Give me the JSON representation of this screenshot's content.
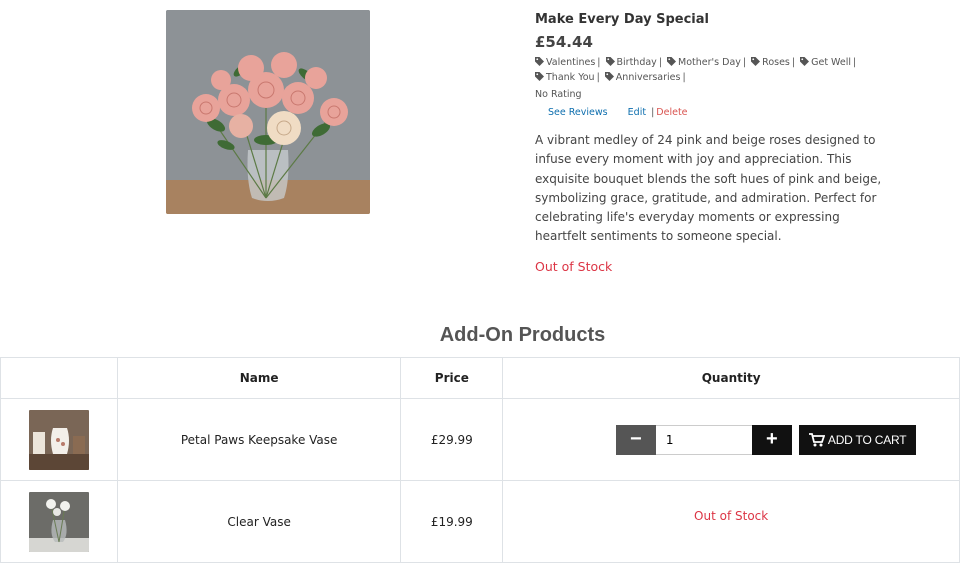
{
  "product": {
    "title": "Make Every Day Special",
    "price": "£54.44",
    "tags": [
      "Valentines",
      "Birthday",
      "Mother's Day",
      "Roses",
      "Get Well",
      "Thank You",
      "Anniversaries"
    ],
    "rating": "No Rating",
    "see_reviews": "See Reviews",
    "edit": "Edit",
    "delete": "Delete",
    "divider": "|",
    "description": "A vibrant medley of 24 pink and beige roses designed to infuse every moment with joy and appreciation. This exquisite bouquet blends the soft hues of pink and beige, symbolizing grace, gratitude, and admiration. Perfect for celebrating life's everyday moments or expressing heartfelt sentiments to someone special.",
    "stock_status": "Out of Stock"
  },
  "addons": {
    "title": "Add-On Products",
    "headers": {
      "image": "",
      "name": "Name",
      "price": "Price",
      "quantity": "Quantity"
    },
    "rows": [
      {
        "name": "Petal Paws Keepsake Vase",
        "price": "£29.99",
        "quantity": "1",
        "add_label": "ADD TO CART"
      },
      {
        "name": "Clear Vase",
        "price": "£19.99",
        "stock_status": "Out of Stock"
      }
    ],
    "minus_symbol": "−",
    "plus_symbol": "+"
  },
  "colors": {
    "out_of_stock": "#dc3545",
    "link": "#0d6eae",
    "button_dark": "#111111"
  }
}
